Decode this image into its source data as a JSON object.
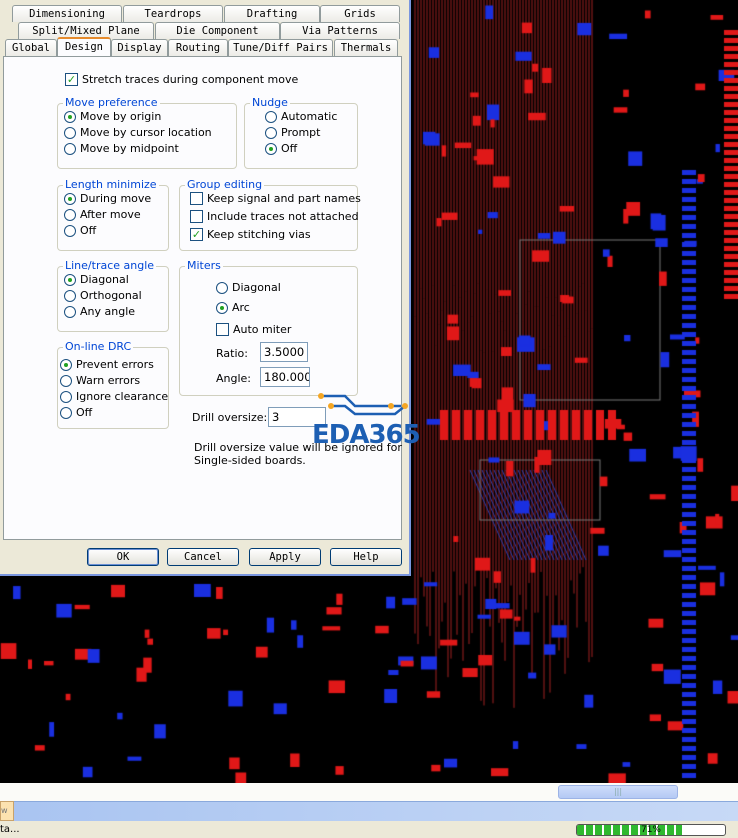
{
  "tabs": {
    "row1": [
      "Dimensioning",
      "Teardrops",
      "Drafting",
      "Grids"
    ],
    "row2": [
      "Split/Mixed Plane",
      "Die Component",
      "Via Patterns"
    ],
    "row3": [
      "Global",
      "Design",
      "Display",
      "Routing",
      "Tune/Diff Pairs",
      "Thermals"
    ],
    "active": "Design"
  },
  "stretch": {
    "label": "Stretch traces during component move",
    "checked": true
  },
  "move_preference": {
    "title": "Move preference",
    "options": [
      "Move by origin",
      "Move by cursor location",
      "Move by midpoint"
    ],
    "selected": 0
  },
  "nudge": {
    "title": "Nudge",
    "options": [
      "Automatic",
      "Prompt",
      "Off"
    ],
    "selected": 2
  },
  "length_minimize": {
    "title": "Length minimize",
    "options": [
      "During move",
      "After move",
      "Off"
    ],
    "selected": 0
  },
  "group_editing": {
    "title": "Group editing",
    "options": [
      "Keep signal and part names",
      "Include traces not attached",
      "Keep stitching vias"
    ],
    "checked": [
      false,
      false,
      true
    ]
  },
  "line_angle": {
    "title": "Line/trace angle",
    "options": [
      "Diagonal",
      "Orthogonal",
      "Any angle"
    ],
    "selected": 0
  },
  "miters": {
    "title": "Miters",
    "options": [
      "Diagonal",
      "Arc"
    ],
    "selected": 1,
    "auto_miter": "Auto miter",
    "ratio_label": "Ratio:",
    "ratio": "3.5000",
    "angle_label": "Angle:",
    "angle": "180.0000"
  },
  "drc": {
    "title": "On-line DRC",
    "options": [
      "Prevent errors",
      "Warn errors",
      "Ignore clearance",
      "Off"
    ],
    "selected": 0
  },
  "drill": {
    "label": "Drill oversize:",
    "value": "3",
    "note1": "Drill oversize value will be ignored for",
    "note2": "Single-sided boards."
  },
  "buttons": {
    "ok": "OK",
    "cancel": "Cancel",
    "apply": "Apply",
    "help": "Help"
  },
  "watermark": "EDA365",
  "taskbar_button": "w",
  "status": {
    "text": "ta...",
    "progress_percent": 71,
    "progress_label": "71%"
  }
}
